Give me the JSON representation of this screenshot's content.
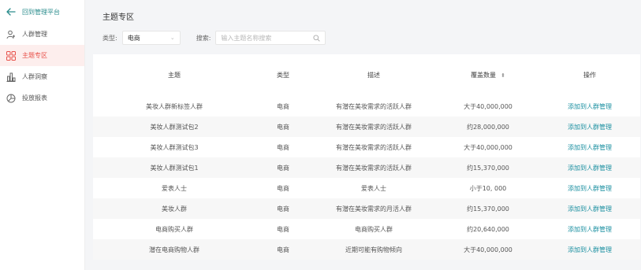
{
  "sidebar": {
    "back_label": "回到管理平台",
    "items": [
      {
        "label": "人群管理",
        "icon": "user-add-icon",
        "active": false
      },
      {
        "label": "主题专区",
        "icon": "grid-icon",
        "active": true
      },
      {
        "label": "人群洞察",
        "icon": "bar-chart-icon",
        "active": false
      },
      {
        "label": "投放报表",
        "icon": "pie-chart-icon",
        "active": false
      }
    ]
  },
  "main": {
    "title": "主题专区",
    "filter_type_label": "类型:",
    "filter_type_value": "电商",
    "filter_search_label": "搜索:",
    "search_placeholder": "输入主题名称搜索"
  },
  "table": {
    "headers": [
      "主题",
      "类型",
      "描述",
      "覆盖数量",
      "操作"
    ],
    "rows": [
      {
        "theme": "美妆人群新标签人群",
        "type": "电商",
        "desc": "有潜在美妆需求的活跃人群",
        "count": "大于40,000,000",
        "action": "添加到人群管理"
      },
      {
        "theme": "美妆人群测试包2",
        "type": "电商",
        "desc": "有潜在美妆需求的活跃人群",
        "count": "约28,000,000",
        "action": "添加到人群管理"
      },
      {
        "theme": "美妆人群测试包3",
        "type": "电商",
        "desc": "有潜在美妆需求的活跃人群",
        "count": "大于40,000,000",
        "action": "添加到人群管理"
      },
      {
        "theme": "美妆人群测试包1",
        "type": "电商",
        "desc": "有潜在美妆需求的活跃人群",
        "count": "约15,370,000",
        "action": "添加到人群管理"
      },
      {
        "theme": "爱表人士",
        "type": "电商",
        "desc": "爱表人士",
        "count": "小于10, 000",
        "action": "添加到人群管理"
      },
      {
        "theme": "美妆人群",
        "type": "电商",
        "desc": "有潜在美妆需求的月活人群",
        "count": "约15,370,000",
        "action": "添加到人群管理"
      },
      {
        "theme": "电商购买人群",
        "type": "电商",
        "desc": "电商购买人群",
        "count": "约20,640,000",
        "action": "添加到人群管理"
      },
      {
        "theme": "潜在电商购物人群",
        "type": "电商",
        "desc": "近期可能有购物倾向",
        "count": "大于40,000,000",
        "action": "添加到人群管理"
      }
    ]
  },
  "colors": {
    "accent": "#2a8c8c",
    "active_text": "#e8514a",
    "active_bg": "#fdeeed",
    "link": "#1a8fa0"
  }
}
